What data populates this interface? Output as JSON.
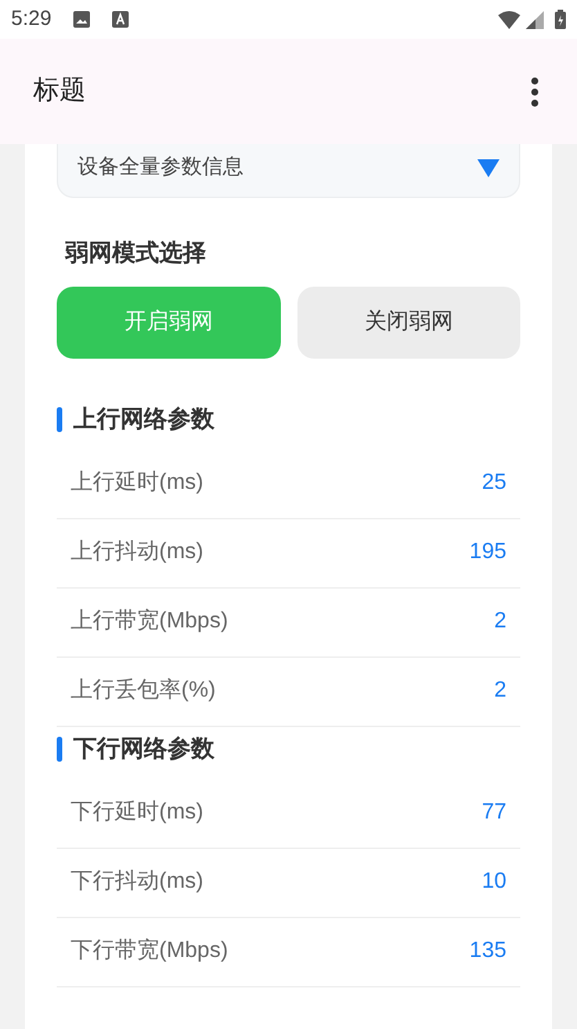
{
  "status_bar": {
    "time": "5:29"
  },
  "app_bar": {
    "title": "标题"
  },
  "dropdown": {
    "value": "设备全量参数信息"
  },
  "mode": {
    "title": "弱网模式选择",
    "buttons": [
      {
        "label": "开启弱网",
        "selected": true
      },
      {
        "label": "关闭弱网",
        "selected": false
      }
    ]
  },
  "sections": [
    {
      "title": "上行网络参数",
      "rows": [
        {
          "label": "上行延时(ms)",
          "value": "25"
        },
        {
          "label": "上行抖动(ms)",
          "value": "195"
        },
        {
          "label": "上行带宽(Mbps)",
          "value": "2"
        },
        {
          "label": "上行丢包率(%)",
          "value": "2"
        }
      ]
    },
    {
      "title": "下行网络参数",
      "rows": [
        {
          "label": "下行延时(ms)",
          "value": "77"
        },
        {
          "label": "下行抖动(ms)",
          "value": "10"
        },
        {
          "label": "下行带宽(Mbps)",
          "value": "135"
        }
      ]
    }
  ]
}
